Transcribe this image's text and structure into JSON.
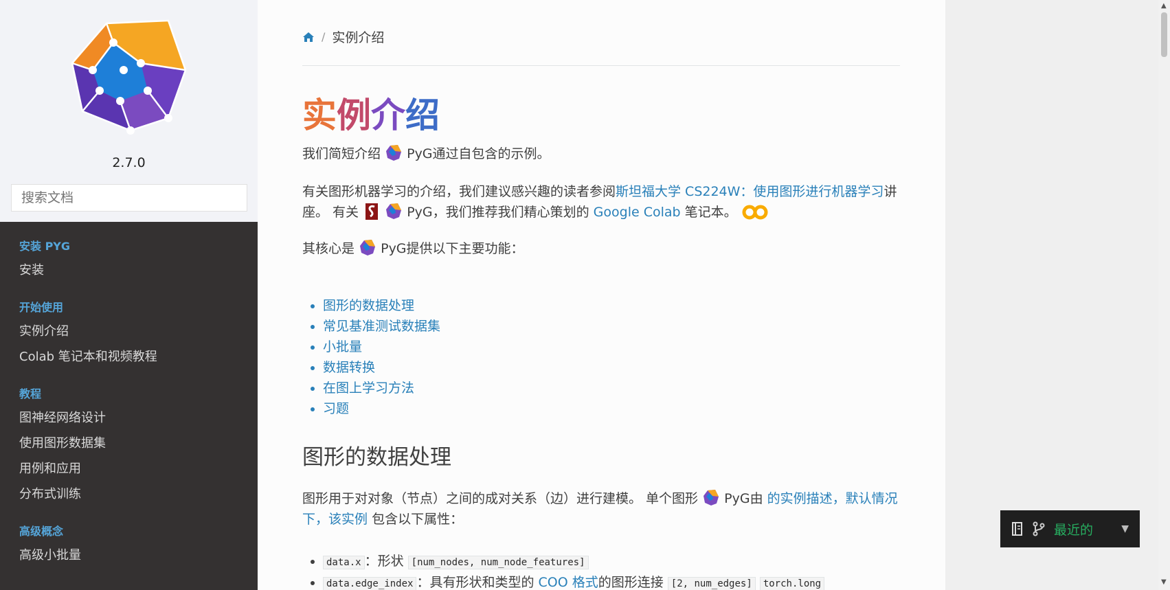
{
  "sidebar": {
    "version": "2.7.0",
    "search_placeholder": "搜索文档",
    "sections": [
      {
        "caption": "安装 PYG",
        "items": [
          "安装"
        ]
      },
      {
        "caption": "开始使用",
        "items": [
          "实例介绍",
          "Colab 笔记本和视频教程"
        ]
      },
      {
        "caption": "教程",
        "items": [
          "图神经网络设计",
          "使用图形数据集",
          "用例和应用",
          "分布式训练"
        ]
      },
      {
        "caption": "高级概念",
        "items": [
          "高级小批量"
        ]
      }
    ]
  },
  "breadcrumb": {
    "current": "实例介绍"
  },
  "page": {
    "title_parts": [
      "实",
      "例",
      "介",
      "绍"
    ],
    "intro": {
      "before": "我们简短介绍",
      "after": "PyG通过自包含的示例。"
    },
    "para2": {
      "before": "有关图形机器学习的介绍，我们建议感兴趣的读者参阅",
      "link1": "斯坦福大学 CS224W：使用图形进行机器学习",
      "mid": "讲座。 有关",
      "mid2": "PyG，我们推荐我们精心策划的 ",
      "link2": "Google Colab",
      "after": " 笔记本。"
    },
    "para3": {
      "before": "其核心是",
      "after": "PyG提供以下主要功能："
    },
    "features": [
      "图形的数据处理",
      "常见基准测试数据集",
      "小批量",
      "数据转换",
      "在图上学习方法",
      "习题"
    ],
    "section_heading": "图形的数据处理",
    "para4": {
      "before": "图形用于对对象（节点）之间的成对关系（边）进行建模。 单个图形",
      "mid": "PyG由",
      "link": "的实例描述，默认情况下，该实例",
      "after": "包含以下属性："
    },
    "attrs": [
      {
        "code": "data.x",
        "sep": "：形状",
        "code2": "[num_nodes, num_node_features]",
        "link": "",
        "rest": "",
        "code3": ""
      },
      {
        "code": "data.edge_index",
        "sep": "：具有形状和类型的 ",
        "link": "COO 格式",
        "rest": "的图形连接",
        "code2": "[2, num_edges]",
        "code3": "torch.long"
      }
    ]
  },
  "version_badge": {
    "label": "最近的"
  },
  "colors": {
    "sidebar_bg": "#343131",
    "caption": "#55a5d9",
    "link": "#2980b9",
    "badge_text": "#27ae60"
  }
}
